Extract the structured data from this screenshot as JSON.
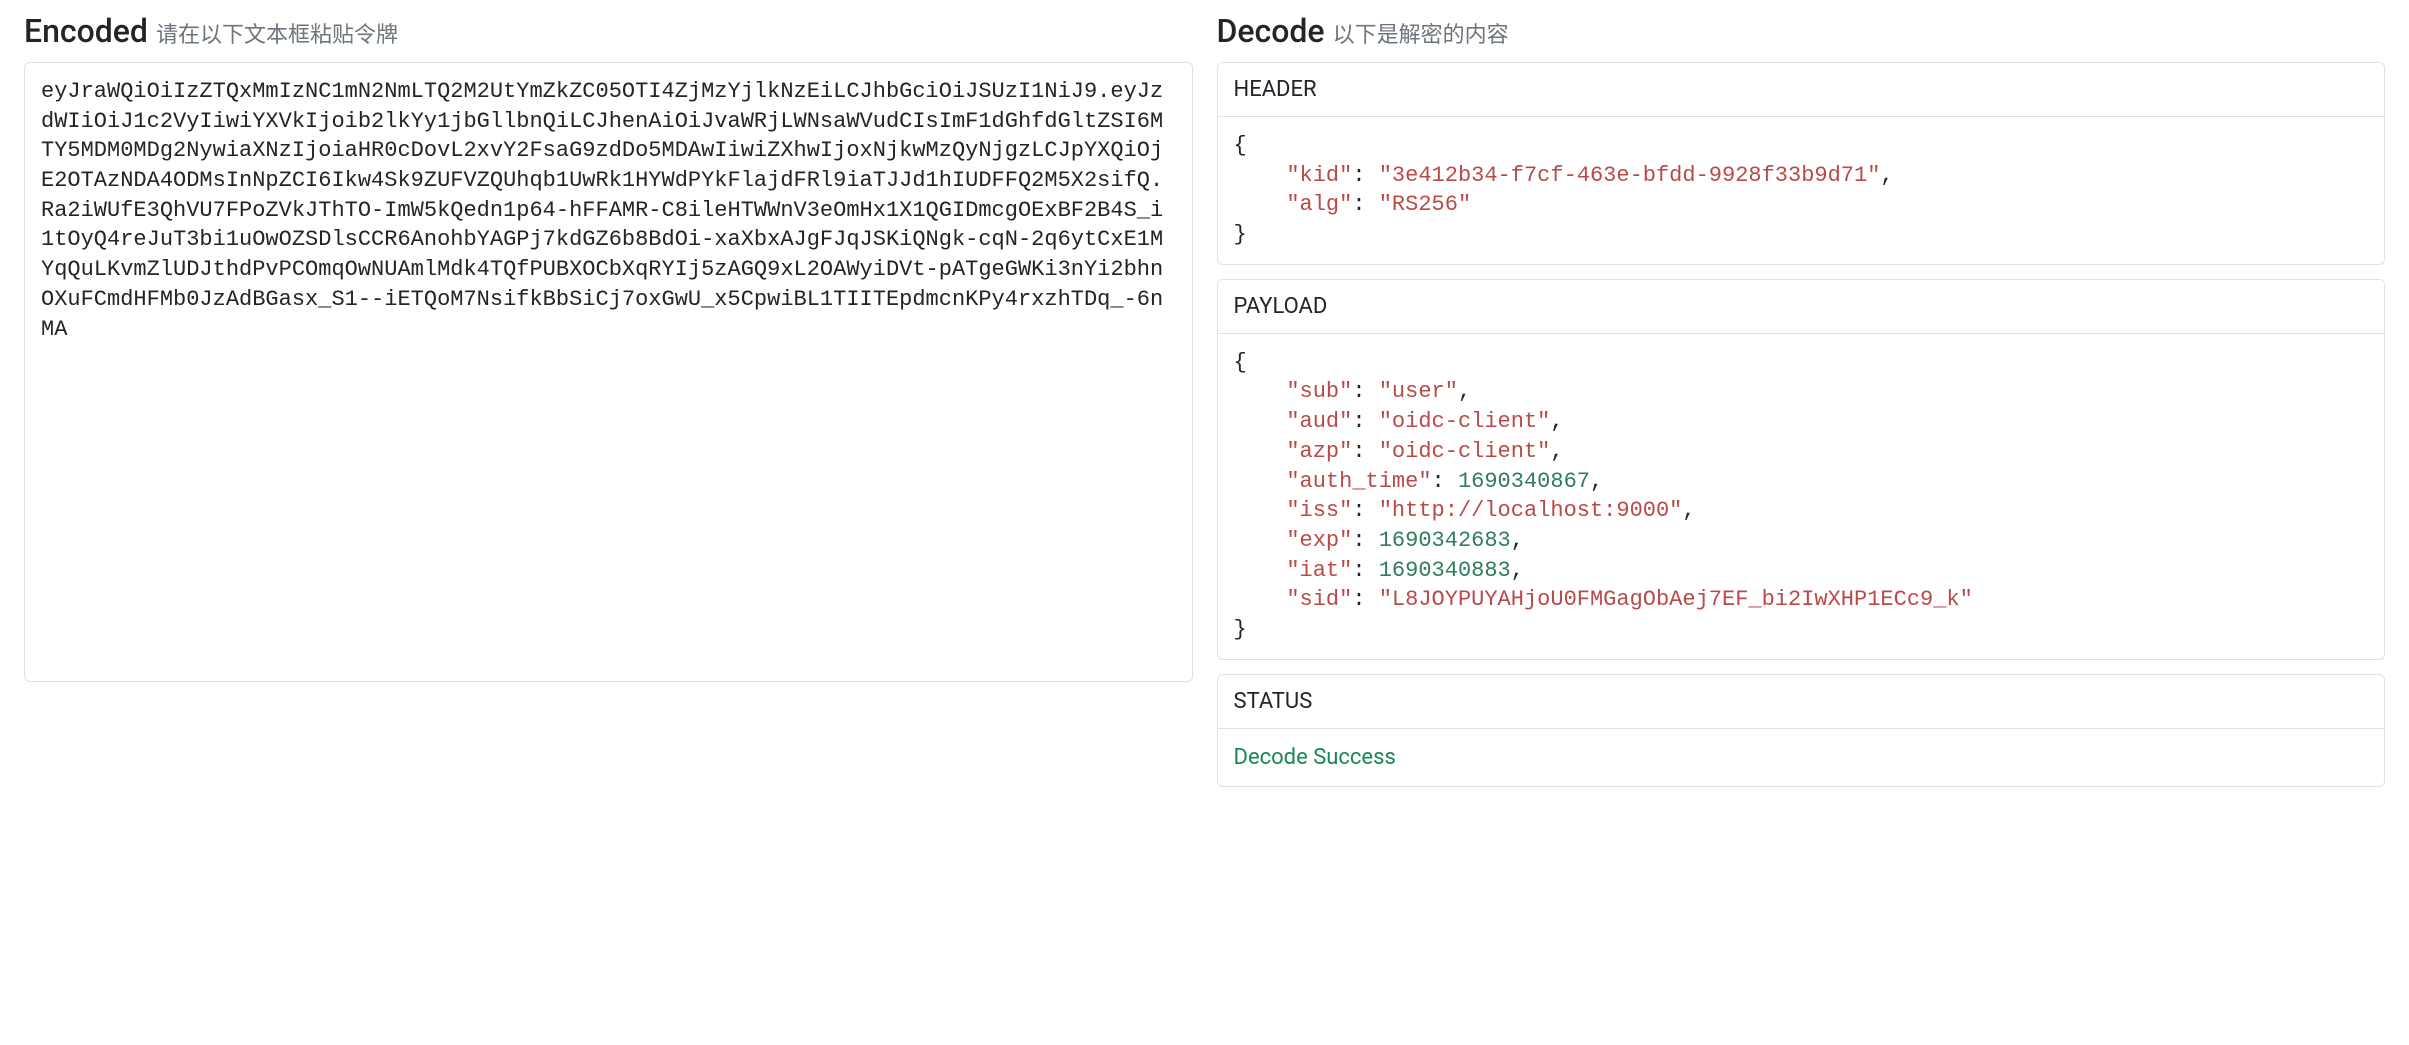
{
  "encoded": {
    "title": "Encoded",
    "subtitle": "请在以下文本框粘贴令牌",
    "value": "eyJraWQiOiIzZTQxMmIzNC1mN2NmLTQ2M2UtYmZkZC05OTI4ZjMzYjlkNzEiLCJhbGciOiJSUzI1NiJ9.eyJzdWIiOiJ1c2VyIiwiYXVkIjoib2lkYy1jbGllbnQiLCJhenAiOiJvaWRjLWNsaWVudCIsImF1dGhfdGltZSI6MTY5MDM0MDg2NywiaXNzIjoiaHR0cDovL2xvY2FsaG9zdDo5MDAwIiwiZXhwIjoxNjkwMzQyNjgzLCJpYXQiOjE2OTAzNDA4ODMsInNpZCI6Ikw4Sk9ZUFVZQUhqb1UwRk1HYWdPYkFlajdFRl9iaTJJd1hIUDFFQ2M5X2sifQ.Ra2iWUfE3QhVU7FPoZVkJThTO-ImW5kQedn1p64-hFFAMR-C8ileHTWWnV3eOmHx1X1QGIDmcgOExBF2B4S_i1tOyQ4reJuT3bi1uOwOZSDlsCCR6AnohbYAGPj7kdGZ6b8BdOi-xaXbxAJgFJqJSKiQNgk-cqN-2q6ytCxE1MYqQuLKvmZlUDJthdPvPCOmqOwNUAmlMdk4TQfPUBXOCbXqRYIj5zAGQ9xL2OAWyiDVt-pATgeGWKi3nYi2bhnOXuFCmdHFMb0JzAdBGasx_S1--iETQoM7NsifkBbSiCj7oxGwU_x5CpwiBL1TIITEpdmcnKPy4rxzhTDq_-6nMA"
  },
  "decode": {
    "title": "Decode",
    "subtitle": "以下是解密的内容",
    "header_label": "HEADER",
    "payload_label": "PAYLOAD",
    "status_label": "STATUS",
    "header_json": {
      "kid": "3e412b34-f7cf-463e-bfdd-9928f33b9d71",
      "alg": "RS256"
    },
    "payload_json": {
      "sub": "user",
      "aud": "oidc-client",
      "azp": "oidc-client",
      "auth_time": 1690340867,
      "iss": "http://localhost:9000",
      "exp": 1690342683,
      "iat": 1690340883,
      "sid": "L8JOYPUYAHjoU0FMGagObAej7EF_bi2IwXHP1ECc9_k"
    },
    "status_text": "Decode Success",
    "status_kind": "success"
  }
}
